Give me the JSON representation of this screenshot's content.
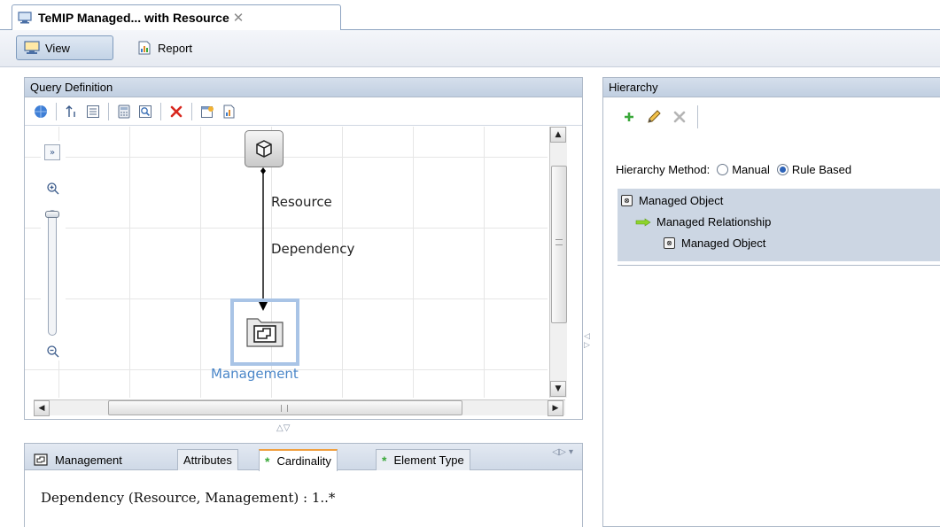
{
  "tab": {
    "title": "TeMIP Managed... with Resource",
    "close_glyph": "✕",
    "icon": "monitor-icon"
  },
  "toolbar": {
    "view_label": "View",
    "report_label": "Report"
  },
  "query_definition": {
    "header": "Query Definition",
    "toolbar_icons": [
      "globe-icon",
      "sort-icon",
      "list-icon",
      "calculator-icon",
      "zoom-rectangle-icon",
      "delete-icon",
      "properties-icon",
      "report-icon"
    ],
    "nodes": {
      "resource_label": "Resource",
      "relationship_label": "Dependency",
      "management_label": "Management"
    }
  },
  "details": {
    "tabs": {
      "management": "Management",
      "attributes": "Attributes",
      "cardinality": "Cardinality",
      "element_type": "Element Type"
    },
    "text": "Dependency (Resource, Management) : 1..*"
  },
  "hierarchy": {
    "header": "Hierarchy",
    "method_label": "Hierarchy Method:",
    "manual_label": "Manual",
    "rule_based_label": "Rule Based",
    "selected_method": "Rule Based",
    "tree": [
      {
        "label": "Managed Object",
        "icon": "cube-icon"
      },
      {
        "label": "Managed Relationship",
        "icon": "arrow-right-icon"
      },
      {
        "label": "Managed Object",
        "icon": "cube-icon"
      }
    ]
  },
  "colors": {
    "header_bg": "#c8d5e6",
    "selection": "#a9c4e6",
    "management_text": "#4a86c8",
    "tree_bg": "#ccd6e3"
  }
}
